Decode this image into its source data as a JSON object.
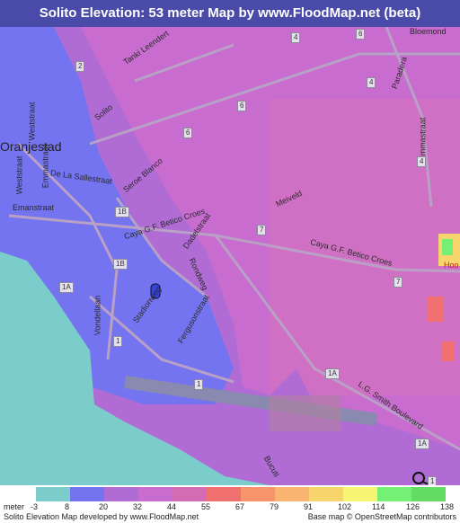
{
  "title": "Solito Elevation: 53 meter Map by www.FloodMap.net (beta)",
  "map": {
    "city_labels": [
      "Oranjestad"
    ],
    "street_labels": [
      "Tanki Leendert",
      "Solito",
      "Seroe Blanco",
      "De La Sallestraat",
      "Emanstraat",
      "Caya G.F. Betico Croes",
      "Meiveld",
      "Dadelstraat",
      "Caya G.F. Betico Croes",
      "Rondweg",
      "Stadionweg",
      "Fergusonstraat",
      "Vondellaan",
      "Weststraat",
      "Emmastraat",
      "Weststraat",
      "Paradera",
      "Bloemond",
      "L.G. Smith Boulevard",
      "Bucuti",
      "Emmastraat"
    ],
    "route_shields": [
      "2",
      "4",
      "6",
      "6",
      "4",
      "6",
      "4",
      "1B",
      "1B",
      "1A",
      "7",
      "7",
      "1",
      "1",
      "1A",
      "1A",
      "1"
    ],
    "partial_label": "Hoo"
  },
  "legend": {
    "unit_label": "meter",
    "colors": [
      "#7ccccc",
      "#7474f0",
      "#b06cd4",
      "#c86cd0",
      "#d46cb4",
      "#f07070",
      "#f8946c",
      "#f8b470",
      "#f8d46c",
      "#f8f474",
      "#74f074",
      "#64dc64"
    ],
    "ticks": [
      "-3",
      "8",
      "20",
      "32",
      "44",
      "55",
      "67",
      "79",
      "91",
      "102",
      "114",
      "126",
      "138"
    ]
  },
  "footer": {
    "left": "Solito Elevation Map developed by www.FloodMap.net",
    "right": "Base map © OpenStreetMap contributors"
  },
  "icons": {
    "marker": "location-marker-icon"
  }
}
